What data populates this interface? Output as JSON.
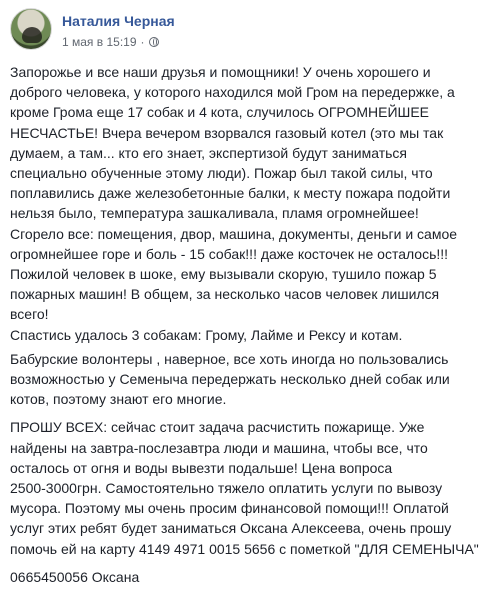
{
  "post": {
    "author": "Наталия Черная",
    "date": "1 мая в 15:19",
    "privacy_icon": "globe-icon",
    "paragraphs": [
      "Запорожье и все наши друзья и помощники! У очень хорошего и\nдоброго человека, у которого находился мой Гром на передержке, а\nкроме Грома еще 17 собак и 4 кота, случилось ОГРОМНЕЙШЕЕ\nНЕСЧАСТЬЕ! Вчера вечером взорвался газовый котел (это мы так\nдумаем, а там... кто его знает, экспертизой будут заниматься\nспециально обученные этому люди). Пожар был такой силы, что\nпоплавились даже железобетонные балки, к месту пожара подойти\nнельзя было, температура зашкаливала, пламя огромнейшее!\nСгорело все: помещения, двор, машина, документы, деньги и самое\nогромнейшее горе и боль - 15 собак!!! даже косточек не осталось!!!\nПожилой человек в шоке, ему вызывали скорую, тушило пожар 5\nпожарных машин! В общем, за несколько часов человек лишился\nвсего!\nСпастись удалось 3 собакам: Грому, Лайме и Рексу и котам.",
      "Бабурские волонтеры , наверное, все хоть иногда но пользовались\nвозможностью у Семеныча передержать несколько дней собак или\nкотов, поэтому знают его многие.",
      "ПРОШУ ВСЕХ: сейчас стоит задача расчистить пожарище. Уже\nнайдены на завтра-послезавтра люди и машина, чтобы все, что\nосталось от огня и воды вывезти подальше! Цена вопроса\n2500-3000грн. Самостоятельно тяжело оплатить услуги по вывозу\nмусора. Поэтому мы очень просим финансовой помощи!!! Оплатой\nуслуг этих ребят будет заниматься Оксана Алексеева, очень прошу\nпомочь ей на карту 4149 4971 0015 5656 с пометкой \"ДЛЯ СЕМЕНЫЧА\"",
      "0665450056 Оксана"
    ]
  }
}
